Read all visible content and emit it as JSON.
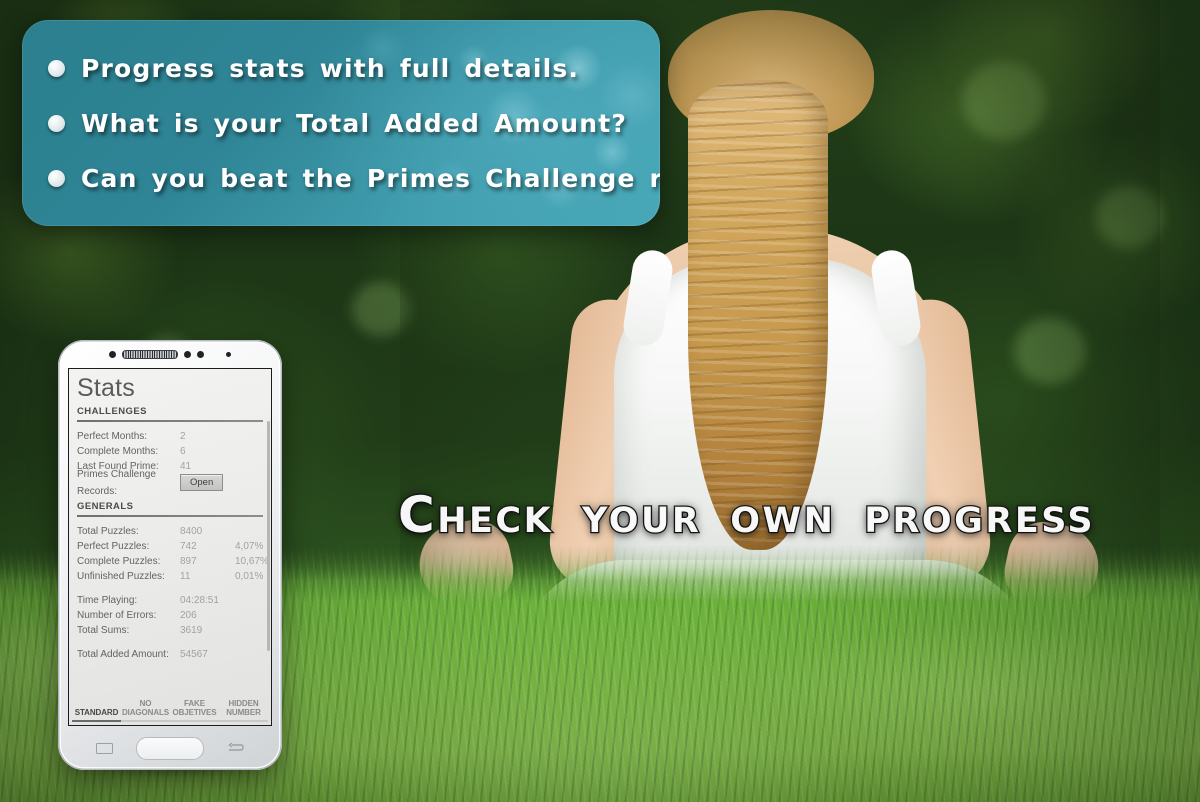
{
  "promo": {
    "bullets": [
      "Progress stats with full details.",
      "What is your Total Added Amount?",
      "Can you beat the Primes Challenge record?"
    ]
  },
  "headline": "Check your own progress",
  "phone": {
    "app": {
      "title": "Stats",
      "sections": [
        {
          "heading": "CHALLENGES",
          "rows": [
            {
              "label": "Perfect Months:",
              "value": "2",
              "pct": ""
            },
            {
              "label": "Complete Months:",
              "value": "6",
              "pct": ""
            },
            {
              "label": "Last Found Prime:",
              "value": "41",
              "pct": ""
            }
          ],
          "action_row": {
            "label": "Primes Challenge Records:",
            "button": "Open"
          }
        },
        {
          "heading": "GENERALS",
          "group_a": [
            {
              "label": "Total Puzzles:",
              "value": "8400",
              "pct": ""
            },
            {
              "label": "Perfect Puzzles:",
              "value": "742",
              "pct": "4,07%"
            },
            {
              "label": "Complete Puzzles:",
              "value": "897",
              "pct": "10,67%"
            },
            {
              "label": "Unfinished Puzzles:",
              "value": "11",
              "pct": "0,01%"
            }
          ],
          "group_b": [
            {
              "label": "Time Playing:",
              "value": "04:28:51",
              "pct": ""
            },
            {
              "label": "Number of Errors:",
              "value": "206",
              "pct": ""
            },
            {
              "label": "Total Sums:",
              "value": "3619",
              "pct": ""
            }
          ],
          "group_c": [
            {
              "label": "Total Added Amount:",
              "value": "54567",
              "pct": ""
            }
          ]
        }
      ]
    },
    "tabs": [
      {
        "line1": "",
        "line2": "STANDARD",
        "active": true
      },
      {
        "line1": "NO",
        "line2": "DIAGONALS",
        "active": false
      },
      {
        "line1": "FAKE",
        "line2": "OBJETIVES",
        "active": false
      },
      {
        "line1": "HIDDEN",
        "line2": "NUMBER",
        "active": false
      }
    ],
    "nav": {
      "recents": "recents-icon",
      "home": "home-button",
      "back": "back-icon"
    }
  },
  "colors": {
    "callout_teal": "#2f8596",
    "callout_bokeh": "#4fb3c4",
    "headline_fill": "#ffffff",
    "headline_outline": "#1c1c1c",
    "screen_bg": "#ececea",
    "value_gray": "#a2a2a2",
    "label_gray": "#636363"
  }
}
